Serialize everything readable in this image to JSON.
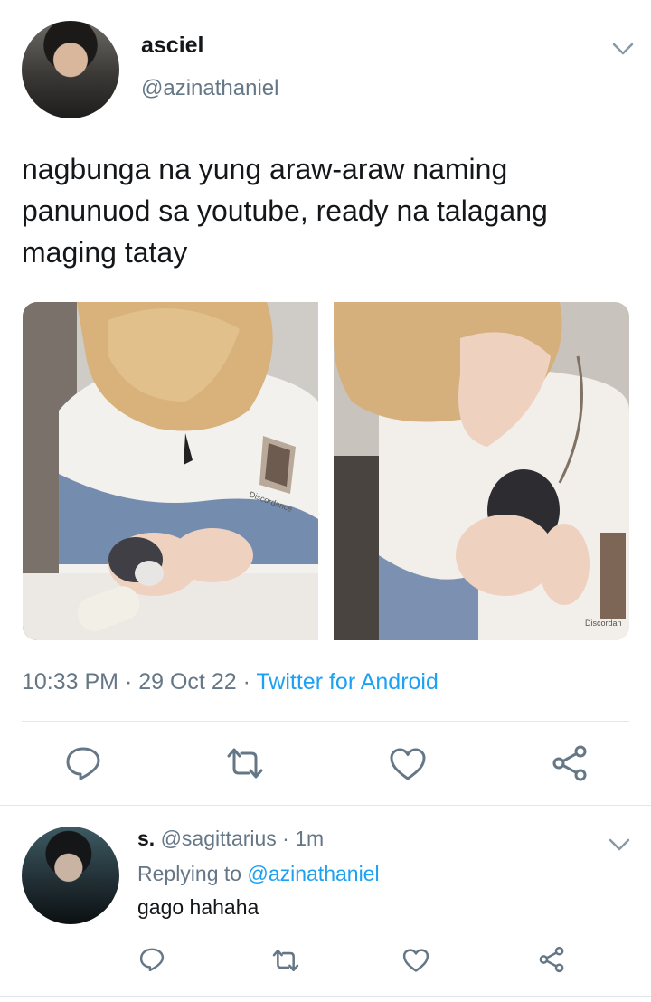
{
  "tweet": {
    "display_name": "asciel",
    "handle": "@azinathaniel",
    "text": "nagbunga na yung araw-araw naming panunuod sa youtube, ready na talagang maging tatay",
    "time": "10:33 PM",
    "date": "29 Oct 22",
    "separator": " · ",
    "source": "Twitter for Android",
    "photo_print_1": "Discordance",
    "photo_print_2": "Discordan"
  },
  "reply": {
    "display_name": "s.",
    "handle": "@sagittarius",
    "time": "1m",
    "replying_prefix": "Replying to ",
    "replying_handle": "@azinathaniel",
    "text": "gago hahaha"
  },
  "icons": {
    "reply": "reply-icon",
    "retweet": "retweet-icon",
    "like": "like-icon",
    "share": "share-icon",
    "chevron": "chevron-down-icon"
  },
  "colors": {
    "accent": "#1da1f2",
    "secondary_text": "#657786",
    "primary_text": "#14171a",
    "divider": "#e1e8ed"
  }
}
